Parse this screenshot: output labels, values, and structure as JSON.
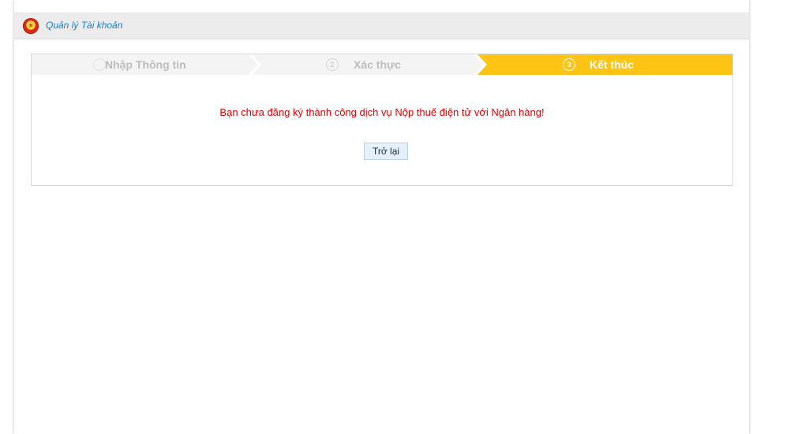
{
  "header": {
    "title": "Quản lý Tài khoản"
  },
  "steps": [
    {
      "number": "1",
      "label": "Nhập Thông tin",
      "state": "done"
    },
    {
      "number": "2",
      "label": "Xác thực",
      "state": "done"
    },
    {
      "number": "3",
      "label": "Kết thúc",
      "state": "active"
    }
  ],
  "result": {
    "message": "Bạn chưa đăng ký thành công dịch vụ Nộp thuế điện tử với Ngân hàng!",
    "back_label": "Trở lại"
  },
  "colors": {
    "active_step": "#fec414",
    "message": "#e10000",
    "header_title": "#1c7fc4"
  }
}
